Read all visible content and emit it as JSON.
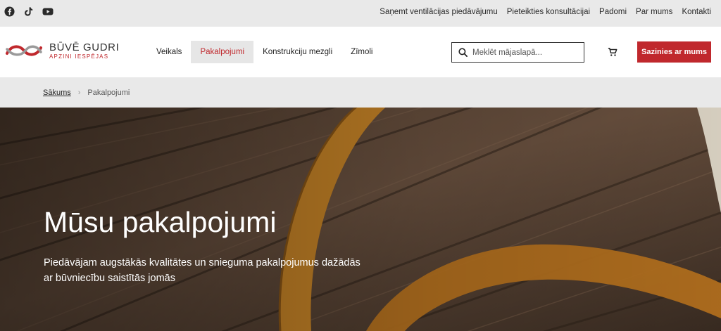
{
  "topbar": {
    "social": [
      "facebook-icon",
      "tiktok-icon",
      "youtube-icon"
    ],
    "links": [
      "Saņemt ventilācijas piedāvājumu",
      "Pieteikties konsultācijai",
      "Padomi",
      "Par mums",
      "Kontakti"
    ]
  },
  "header": {
    "logo_brand": "BŪVĒ GUDRI",
    "logo_tagline": "APZINI IESPĒJAS",
    "nav": [
      "Veikals",
      "Pakalpojumi",
      "Konstrukciju mezgli",
      "Zīmoli"
    ],
    "active_nav": "Pakalpojumi",
    "search_placeholder": "Meklēt mājaslapā...",
    "cta_label": "Sazinies ar mums"
  },
  "breadcrumb": {
    "home": "Sākums",
    "current": "Pakalpojumi"
  },
  "hero": {
    "title": "Mūsu pakalpojumi",
    "subtitle": "Piedāvājam augstākās kvalitātes un snieguma pakalpojumus dažādās ar būvniecību saistītās jomās"
  },
  "colors": {
    "accent": "#c0282d",
    "topbar_bg": "#e9e9e9",
    "wood": "#4a382b",
    "tape": "#d08a2c"
  }
}
